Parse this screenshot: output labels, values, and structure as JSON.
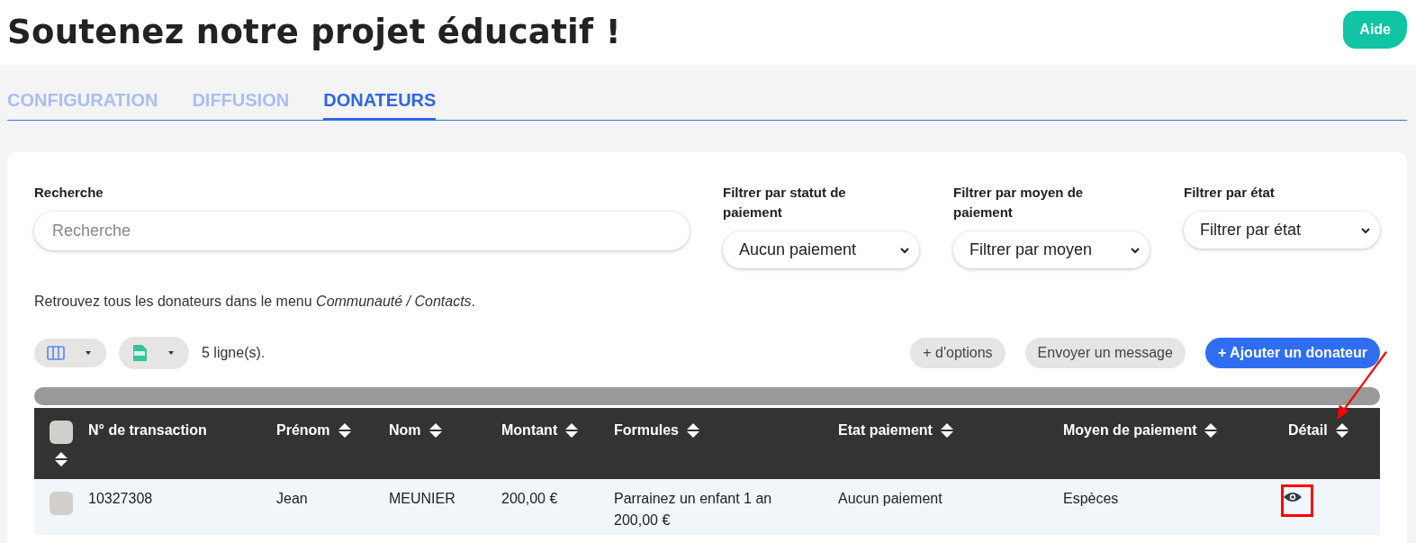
{
  "page": {
    "title": "Soutenez notre projet éducatif !",
    "help_button": "Aide"
  },
  "tabs": [
    {
      "label": "CONFIGURATION",
      "selected": false
    },
    {
      "label": "DIFFUSION",
      "selected": false
    },
    {
      "label": "DONATEURS",
      "selected": true
    }
  ],
  "filters": {
    "search": {
      "label": "Recherche",
      "placeholder": "Recherche"
    },
    "selects": [
      {
        "label": "Filtrer par statut de paiement",
        "value": "Aucun paiement"
      },
      {
        "label": "Filtrer par moyen de paiement",
        "value": "Filtrer par moyen"
      },
      {
        "label": "Filtrer par état",
        "value": "Filtrer par état"
      }
    ]
  },
  "info": "Retrouvez tous les donateurs dans le menu *Communauté / Contacts*.",
  "toolbar": {
    "row_count": "5 ligne(s).",
    "buttons": [
      {
        "label": "+ d'options",
        "primary": false
      },
      {
        "label": "Envoyer un message",
        "primary": false
      },
      {
        "label": "+ Ajouter un donateur",
        "primary": true
      }
    ]
  },
  "table": {
    "select_all": {
      "checked": false,
      "sortable": true
    },
    "columns": [
      {
        "label": "N° de transaction",
        "sortable": false
      },
      {
        "label": "Prénom",
        "sortable": true
      },
      {
        "label": "Nom",
        "sortable": true
      },
      {
        "label": "Montant",
        "sortable": true
      },
      {
        "label": "Formules",
        "sortable": true
      },
      {
        "label": "Etat paiement",
        "sortable": true
      },
      {
        "label": "Moyen de paiement",
        "sortable": true
      },
      {
        "label": "Détail",
        "sortable": true
      }
    ],
    "rows": [
      {
        "checked": false,
        "cells": [
          "10327308",
          "Jean",
          "MEUNIER",
          "200,00 €",
          "Parrainez un enfant 1 an 200,00 €",
          "Aucun paiement",
          "Espèces"
        ],
        "detail_highlighted": true
      }
    ]
  }
}
